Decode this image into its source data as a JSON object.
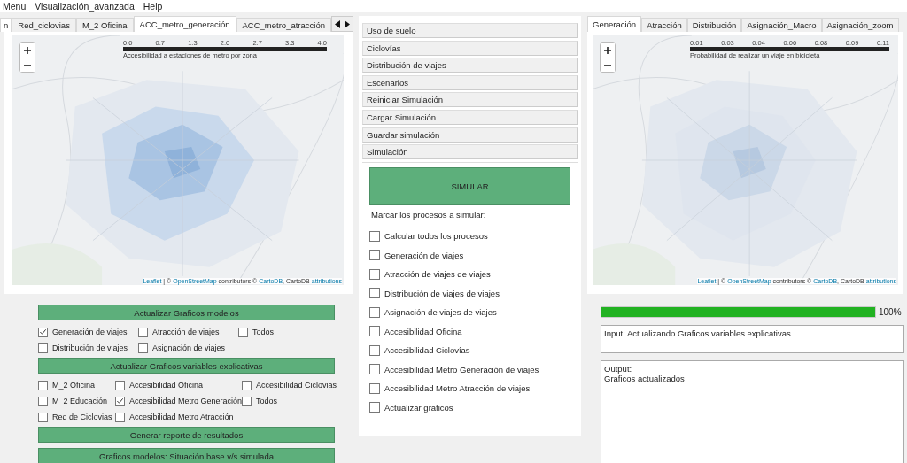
{
  "menu": [
    "Menu",
    "Visualización_avanzada",
    "Help"
  ],
  "left_panel": {
    "tabs": [
      {
        "label": "n",
        "selected": false
      },
      {
        "label": "Red_ciclovias",
        "selected": false
      },
      {
        "label": "M_2 Oficina",
        "selected": false
      },
      {
        "label": "ACC_metro_generación",
        "selected": true
      },
      {
        "label": "ACC_metro_atracción",
        "selected": false
      }
    ],
    "map": {
      "kind": "picture",
      "legend": {
        "ticks": [
          "0.0",
          "0.7",
          "1.3",
          "2.0",
          "2.7",
          "3.3",
          "4.0"
        ],
        "title": "Accesibilidad a estaciones de metro por zona"
      },
      "attribution": [
        {
          "text": "Leaflet",
          "link": true
        },
        {
          "text": " | © ",
          "link": false
        },
        {
          "text": "OpenStreetMap",
          "link": true
        },
        {
          "text": " contributors © ",
          "link": false
        },
        {
          "text": "CartoDB",
          "link": true
        },
        {
          "text": ", CartoDB ",
          "link": false
        },
        {
          "text": "attributions",
          "link": true
        }
      ]
    },
    "sections": [
      {
        "button": "Actualizar Graficos modelos",
        "rows": [
          [
            {
              "label": "Generación de viajes",
              "checked": true
            },
            {
              "label": "Atracción de viajes",
              "checked": false
            },
            {
              "label": "Todos",
              "checked": false
            }
          ],
          [
            {
              "label": "Distribución de viajes",
              "checked": false
            },
            {
              "label": "Asignación de viajes",
              "checked": false
            }
          ]
        ]
      },
      {
        "button": "Actualizar  Graficos variables explicativas",
        "rows": [
          [
            {
              "label": "M_2 Oficina",
              "checked": false
            },
            {
              "label": "Accesibilidad Oficina",
              "checked": false
            },
            {
              "label": "Accesibilidad Ciclovias",
              "checked": false
            }
          ],
          [
            {
              "label": "M_2 Educación",
              "checked": false
            },
            {
              "label": "Accesibilidad Metro Generación",
              "checked": true
            },
            {
              "label": "Todos",
              "checked": false
            }
          ],
          [
            {
              "label": "Red de Ciclovias",
              "checked": false
            },
            {
              "label": "Accesibilidad Metro Atracción",
              "checked": false
            }
          ]
        ]
      },
      {
        "button": "Generar reporte de resultados"
      },
      {
        "button": "Graficos modelos: Situación base v/s simulada"
      }
    ]
  },
  "middle_panel": {
    "accordion": [
      "Uso de suelo",
      "Ciclovías",
      "Distribución de viajes",
      "Escenarios",
      "Reiniciar Simulación",
      "Cargar Simulación",
      "Guardar simulación",
      "Simulación"
    ],
    "simulate_button": "SIMULAR",
    "prompt": "Marcar los procesos a simular:",
    "processes": [
      {
        "label": "Calcular todos los procesos",
        "checked": false
      },
      {
        "label": "Generación de viajes",
        "checked": false
      },
      {
        "label": "Atracción de viajes de viajes",
        "checked": false
      },
      {
        "label": "Distribución de viajes de viajes",
        "checked": false
      },
      {
        "label": "Asignación de viajes de viajes",
        "checked": false
      },
      {
        "label": "Accesibilidad Oficina",
        "checked": false
      },
      {
        "label": "Accesibilidad Ciclovías",
        "checked": false
      },
      {
        "label": "Accesibilidad Metro Generación de viajes",
        "checked": false
      },
      {
        "label": "Accesibilidad Metro Atracción de viajes",
        "checked": false
      },
      {
        "label": "Actualizar graficos",
        "checked": false
      }
    ]
  },
  "right_panel": {
    "tabs": [
      {
        "label": "Generación",
        "selected": true
      },
      {
        "label": "Atracción",
        "selected": false
      },
      {
        "label": "Distribución",
        "selected": false
      },
      {
        "label": "Asignación_Macro",
        "selected": false
      },
      {
        "label": "Asignación_zoom",
        "selected": false
      }
    ],
    "map": {
      "kind": "picture",
      "legend": {
        "ticks": [
          "0.01",
          "0.03",
          "0.04",
          "0.06",
          "0.08",
          "0.09",
          "0.11"
        ],
        "title": "Probabilidad de realizar un viaje en bicicleta"
      },
      "attribution": [
        {
          "text": "Leaflet",
          "link": true
        },
        {
          "text": " | © ",
          "link": false
        },
        {
          "text": "OpenStreetMap",
          "link": true
        },
        {
          "text": " contributors © ",
          "link": false
        },
        {
          "text": "CartoDB",
          "link": true
        },
        {
          "text": ", CartoDB ",
          "link": false
        },
        {
          "text": "attributions",
          "link": true
        }
      ]
    },
    "progress": {
      "level": 1,
      "reading": "100%"
    },
    "input_log": "Input: Actualizando Graficos variables explicativas..",
    "output_log": [
      "Output:",
      "Graficos actualizados"
    ]
  }
}
